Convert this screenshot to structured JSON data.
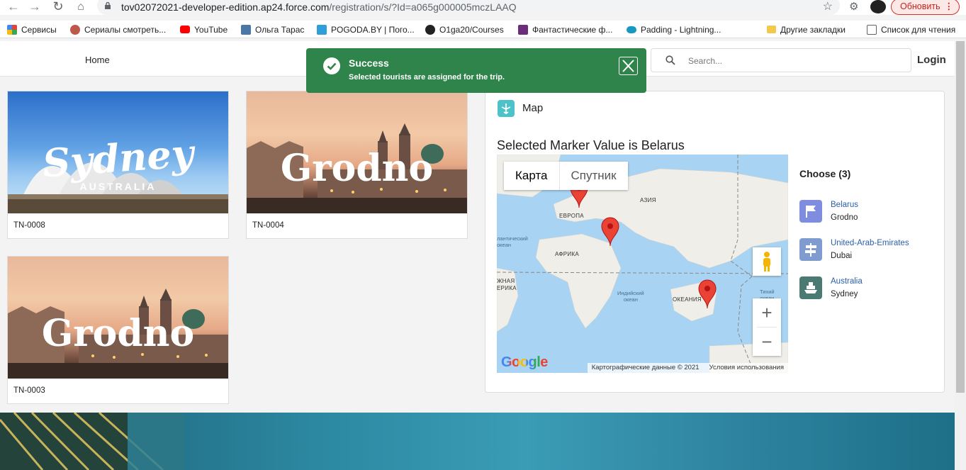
{
  "browser": {
    "url_host": "tov02072021-developer-edition.ap24.force.com",
    "url_path": "/registration/s/?Id=a065g000005mczLAAQ",
    "update_label": "Обновить",
    "bookmarks": [
      {
        "label": "Сервисы",
        "color": "#e0453a"
      },
      {
        "label": "Сериалы смотреть...",
        "color": "#c0584a"
      },
      {
        "label": "YouTube",
        "color": "#ff0000"
      },
      {
        "label": "Ольга Тарас",
        "color": "#4a76a8"
      },
      {
        "label": "POGODA.BY | Пого...",
        "color": "#2e9fd9"
      },
      {
        "label": "O1ga20/Courses",
        "color": "#222222"
      },
      {
        "label": "Фантастические ф...",
        "color": "#6b2d7a"
      },
      {
        "label": "Padding - Lightning...",
        "color": "#1798c1"
      },
      {
        "label": "Другие закладки",
        "color": "#f2c94c"
      },
      {
        "label": "Список для чтения",
        "color": "#5f6368"
      }
    ]
  },
  "header": {
    "home": "Home",
    "search_placeholder": "Search...",
    "login": "Login"
  },
  "toast": {
    "title": "Success",
    "message": "Selected tourists are assigned for the trip."
  },
  "trips": [
    {
      "id": "TN-0008",
      "image_word": "Sydney",
      "image_subword": "AUSTRALIA"
    },
    {
      "id": "TN-0004",
      "image_word": "Grodno"
    },
    {
      "id": "TN-0003",
      "image_word": "Grodno"
    }
  ],
  "map_panel": {
    "title": "Map",
    "marker_text": "Selected Marker Value is Belarus",
    "map_types": [
      "Карта",
      "Спутник"
    ],
    "credits": "Картографические данные © 2021",
    "terms": "Условия использования",
    "google": "Google",
    "geo_labels": [
      "ЕВРОПА",
      "АЗИЯ",
      "АФРИКА",
      "ОКЕАНИЯ"
    ],
    "ocean_labels": [
      "лантический\nокеан",
      "Индийский\nокеан",
      "Тихий\nокеан"
    ],
    "edge_label": "ЖНАЯ\nЕРИКА",
    "choose_title": "Choose (3)",
    "locations": [
      {
        "country": "Belarus",
        "city": "Grodno",
        "color": "#7f8de1"
      },
      {
        "country": "United-Arab-Emirates",
        "city": "Dubai",
        "color": "#7f9bd0"
      },
      {
        "country": "Australia",
        "city": "Sydney",
        "color": "#4b7a73"
      }
    ]
  },
  "colors": {
    "toast_bg": "#2e844a",
    "link": "#2a5fa8",
    "map_accent": "#4bc3c9",
    "marker": "#ea4335"
  }
}
